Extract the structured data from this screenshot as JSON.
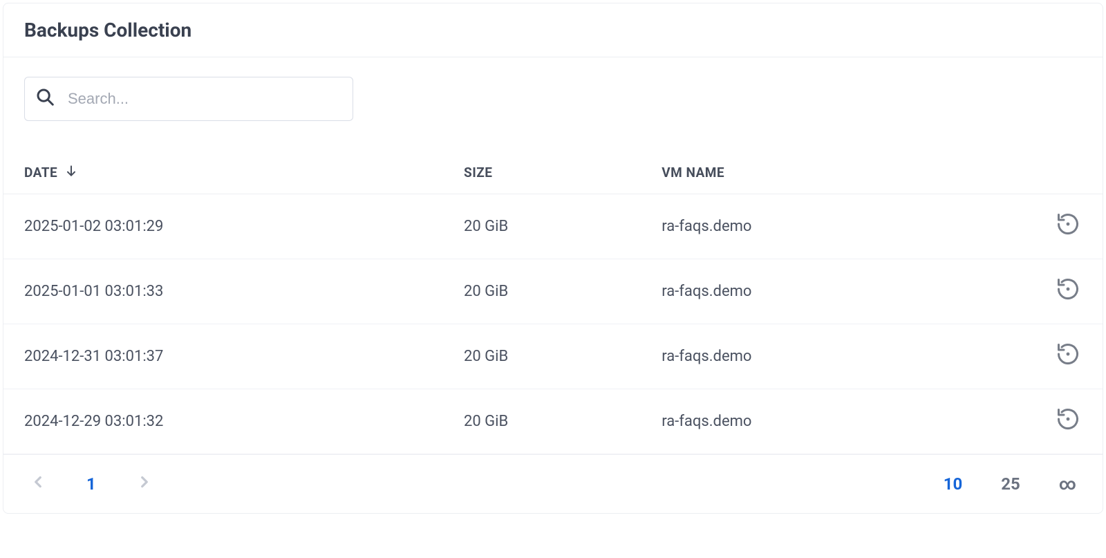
{
  "header": {
    "title": "Backups Collection"
  },
  "search": {
    "placeholder": "Search...",
    "value": ""
  },
  "table": {
    "columns": {
      "date": "DATE",
      "size": "SIZE",
      "vm": "VM NAME"
    },
    "sort": {
      "column": "date",
      "direction": "desc"
    },
    "rows": [
      {
        "date": "2025-01-02 03:01:29",
        "size": "20 GiB",
        "vm": "ra-faqs.demo"
      },
      {
        "date": "2025-01-01 03:01:33",
        "size": "20 GiB",
        "vm": "ra-faqs.demo"
      },
      {
        "date": "2024-12-31 03:01:37",
        "size": "20 GiB",
        "vm": "ra-faqs.demo"
      },
      {
        "date": "2024-12-29 03:01:32",
        "size": "20 GiB",
        "vm": "ra-faqs.demo"
      }
    ],
    "row_action_label": "Restore"
  },
  "pager": {
    "current_page": "1",
    "page_sizes": [
      "10",
      "25",
      "∞"
    ],
    "active_size": "10"
  },
  "colors": {
    "accent": "#1565d8"
  }
}
